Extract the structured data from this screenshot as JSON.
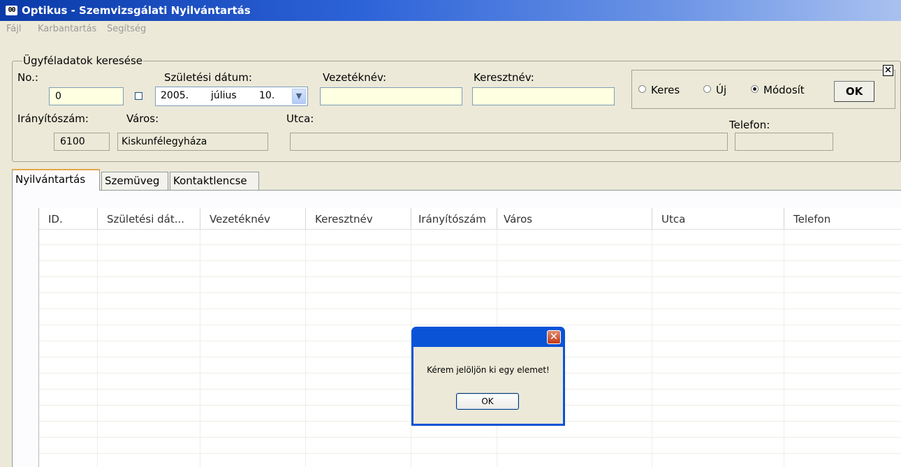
{
  "window": {
    "title": "Optikus - Szemvizsgálati Nyilvántartás",
    "icon_glyph": "00",
    "icon_name": "glasses-icon"
  },
  "menu": [
    "Fájl",
    "Karbantartás",
    "Segítség"
  ],
  "search": {
    "legend": "Ügyféladatok keresése",
    "labels": {
      "no": "No.:",
      "birth_date": "Születési dátum:",
      "last_name": "Vezetéknév:",
      "first_name": "Keresztnév:",
      "zip": "Irányítószám:",
      "city": "Város:",
      "street": "Utca:",
      "phone": "Telefon:"
    },
    "values": {
      "no": "0",
      "birth_year": "2005.",
      "birth_month": "július",
      "birth_day": "10.",
      "last_name": "",
      "first_name": "",
      "zip": "6100",
      "city": "Kiskunfélegyháza",
      "street": "",
      "phone": ""
    },
    "date_checkbox_checked": false,
    "close_glyph": "×"
  },
  "mode": {
    "options": [
      "Keres",
      "Új",
      "Módosít"
    ],
    "selected": "Módosít",
    "ok_label": "OK"
  },
  "tabs": [
    "Nyilvántartás",
    "Szemüveg",
    "Kontaktlencse"
  ],
  "active_tab": "Nyilvántartás",
  "grid": {
    "columns": [
      "ID.",
      "Születési dát...",
      "Vezetéknév",
      "Keresztnév",
      "Irányítószám",
      "Város",
      "Utca",
      "Telefon"
    ],
    "rows": []
  },
  "dialog": {
    "close_glyph": "✕",
    "message": "Kérem jelöljön ki egy elemet!",
    "ok_label": "OK"
  },
  "colors": {
    "titlebar_start": "#0a3aa8",
    "dialog_frame": "#0a53d7",
    "input_yellow": "#ffffe1",
    "window_bg": "#ece9d8"
  }
}
